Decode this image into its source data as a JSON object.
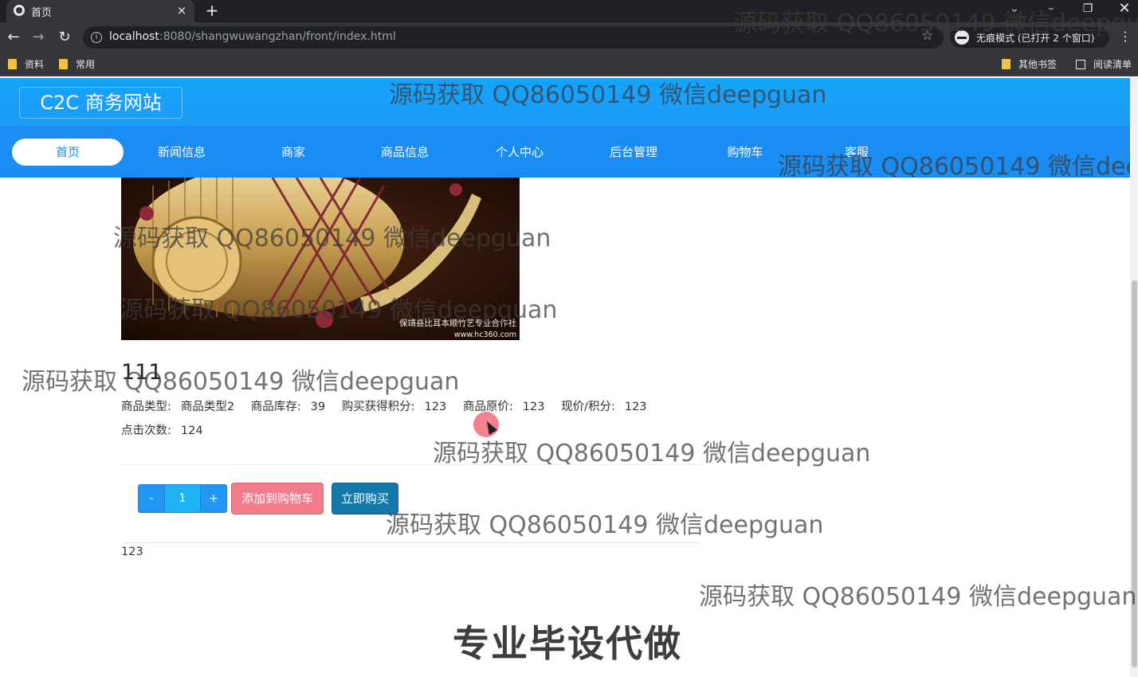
{
  "browser": {
    "tab_title": "首页",
    "new_tab_symbol": "+",
    "close_symbol": "×",
    "url_host": "localhost",
    "url_path": ":8080/shangwuwangzhan/front/index.html",
    "incognito_text": "无痕模式 (已打开 2 个窗口)",
    "bookmarks": [
      "资料",
      "常用"
    ],
    "bookmarks_right": [
      "其他书签",
      "阅读清单"
    ],
    "icons": [
      "globe-icon",
      "back-icon",
      "forward-icon",
      "reload-icon",
      "info-icon",
      "star-icon",
      "incognito-icon",
      "menu-icon",
      "folder-icon",
      "reading-list-icon"
    ]
  },
  "site": {
    "brand": "C2C 商务网站",
    "accent_color": "#1a8cf2",
    "nav": [
      {
        "label": "首页",
        "active": true
      },
      {
        "label": "新闻信息"
      },
      {
        "label": "商家"
      },
      {
        "label": "商品信息"
      },
      {
        "label": "个人中心"
      },
      {
        "label": "后台管理"
      },
      {
        "label": "购物车"
      },
      {
        "label": "客服"
      }
    ]
  },
  "product": {
    "image_caption": "保靖县比耳本顺竹艺专业合作社",
    "image_url_text": "www.hc360.com",
    "title": "111",
    "meta": [
      {
        "label": "商品类型:",
        "value": "商品类型2"
      },
      {
        "label": "商品库存:",
        "value": "39"
      },
      {
        "label": "购买获得积分:",
        "value": "123"
      },
      {
        "label": "商品原价:",
        "value": "123"
      },
      {
        "label": "现价/积分:",
        "value": "123"
      }
    ],
    "clicks_label": "点击次数:",
    "clicks_value": "124",
    "qty_minus": "-",
    "qty_value": "1",
    "qty_plus": "+",
    "add_to_cart": "添加到购物车",
    "buy_now": "立即购买",
    "description": "123"
  },
  "overlays": {
    "watermark": "源码获取 QQ86050149 微信deepguan",
    "banner": "专业毕设代做"
  }
}
